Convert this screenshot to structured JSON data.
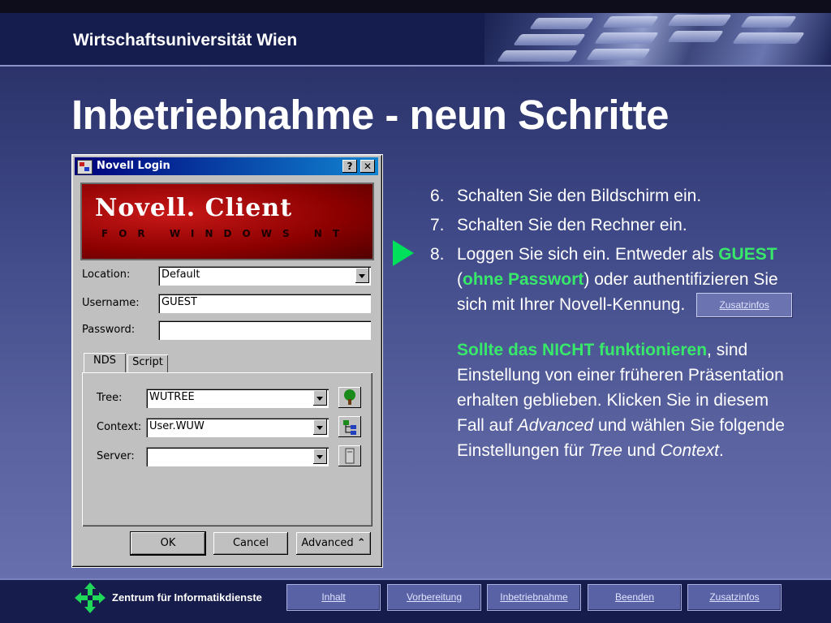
{
  "header": {
    "university": "Wirtschaftsuniversität Wien"
  },
  "slide": {
    "title": "Inbetriebnahme - neun Schritte"
  },
  "dialog": {
    "title": "Novell Login",
    "help_btn": "?",
    "close_btn": "✕",
    "banner_brand": "Novell. Client",
    "banner_sub": "FOR WINDOWS NT",
    "location_label": "Location:",
    "location_value": "Default",
    "username_label": "Username:",
    "username_value": "GUEST",
    "password_label": "Password:",
    "password_value": "",
    "tabs": [
      "NDS",
      "Script"
    ],
    "tree_label": "Tree:",
    "tree_value": "WUTREE",
    "context_label": "Context:",
    "context_value": "User.WUW",
    "server_label": "Server:",
    "server_value": "",
    "ok_label": "OK",
    "cancel_label": "Cancel",
    "advanced_label": "Advanced"
  },
  "steps": [
    {
      "num": "6.",
      "text": "Schalten Sie den Bildschirm ein."
    },
    {
      "num": "7.",
      "text": "Schalten Sie den Rechner ein."
    },
    {
      "num": "8.",
      "pre": "Loggen Sie sich ein. Entweder als ",
      "guest": "GUEST",
      "open": " (",
      "nopw": "ohne Passwort",
      "close": ") oder authentifizieren Sie sich mit Ihrer Novell-Kennung.",
      "button": "Zusatzinfos"
    }
  ],
  "note": {
    "bold": "Sollte das NICHT funktionieren",
    "after_bold": ", sind Einstellung von einer früheren Präsentation erhalten geblieben. Klicken Sie in diesem Fall auf ",
    "adv": "Advanced",
    "mid": " und wählen Sie folgende Einstellungen für ",
    "tree": "Tree",
    "und": " und ",
    "context": "Context",
    "end": "."
  },
  "footer": {
    "org": "Zentrum für Informatikdienste",
    "nav": [
      "Inhalt",
      "Vorbereitung",
      "Inbetriebnahme",
      "Beenden",
      "Zusatzinfos"
    ]
  },
  "colors": {
    "accent_green": "#38e86a",
    "arrow_green": "#00e05a",
    "title_bar": "#00007b"
  }
}
